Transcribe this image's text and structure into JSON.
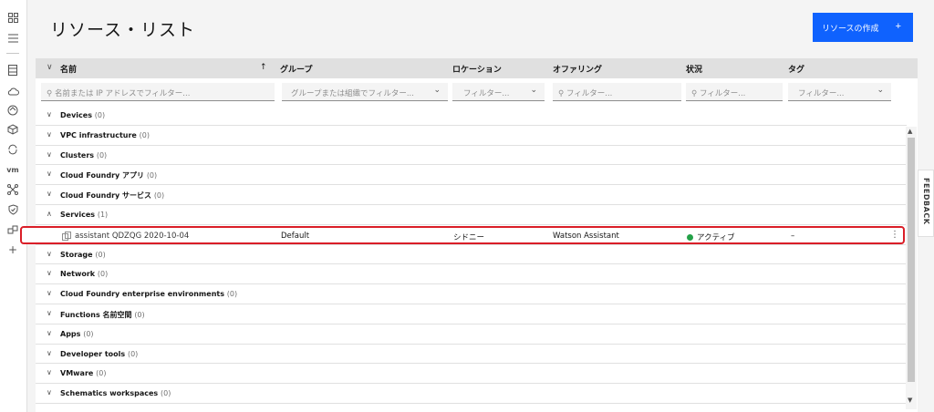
{
  "page": {
    "title": "リソース・リスト",
    "create_button": "リソースの作成"
  },
  "columns": {
    "name": "名前",
    "sort_arrow": "↑",
    "group": "グループ",
    "location": "ロケーション",
    "offering": "オファリング",
    "status": "状況",
    "tags": "タグ"
  },
  "filters": {
    "name_placeholder": "名前または IP アドレスでフィルター...",
    "group_placeholder": "グループまたは組織でフィルター...",
    "location_placeholder": "フィルター...",
    "offering_placeholder": "フィルター...",
    "status_placeholder": "フィルター...",
    "tags_placeholder": "フィルター..."
  },
  "categories": [
    {
      "label": "Devices",
      "count": "(0)",
      "expanded": false
    },
    {
      "label": "VPC infrastructure",
      "count": "(0)",
      "expanded": false
    },
    {
      "label": "Clusters",
      "count": "(0)",
      "expanded": false
    },
    {
      "label": "Cloud Foundry アプリ",
      "count": "(0)",
      "expanded": false
    },
    {
      "label": "Cloud Foundry サービス",
      "count": "(0)",
      "expanded": false
    },
    {
      "label": "Services",
      "count": "(1)",
      "expanded": true
    },
    {
      "label": "Storage",
      "count": "(0)",
      "expanded": false
    },
    {
      "label": "Network",
      "count": "(0)",
      "expanded": false
    },
    {
      "label": "Cloud Foundry enterprise environments",
      "count": "(0)",
      "expanded": false
    },
    {
      "label": "Functions 名前空間",
      "count": "(0)",
      "expanded": false
    },
    {
      "label": "Apps",
      "count": "(0)",
      "expanded": false
    },
    {
      "label": "Developer tools",
      "count": "(0)",
      "expanded": false
    },
    {
      "label": "VMware",
      "count": "(0)",
      "expanded": false
    },
    {
      "label": "Schematics workspaces",
      "count": "(0)",
      "expanded": false
    }
  ],
  "service_row": {
    "name": "assistant QDZQG 2020-10-04",
    "group": "Default",
    "location": "シドニー",
    "offering": "Watson Assistant",
    "status": "アクティブ",
    "status_color": "#24a148",
    "tags": "–"
  },
  "rail_icons": [
    "dashboard-icon",
    "list-icon",
    "storage-icon",
    "cloud-icon",
    "cloud-foundry-icon",
    "cube-icon",
    "sync-icon",
    "vm-icon",
    "network-icon",
    "security-icon",
    "services-icon",
    "add-icon"
  ],
  "rail_vm_label": "vm",
  "feedback": "FEEDBACK",
  "accent_color": "#0f62fe",
  "highlight_color": "#da1e28"
}
